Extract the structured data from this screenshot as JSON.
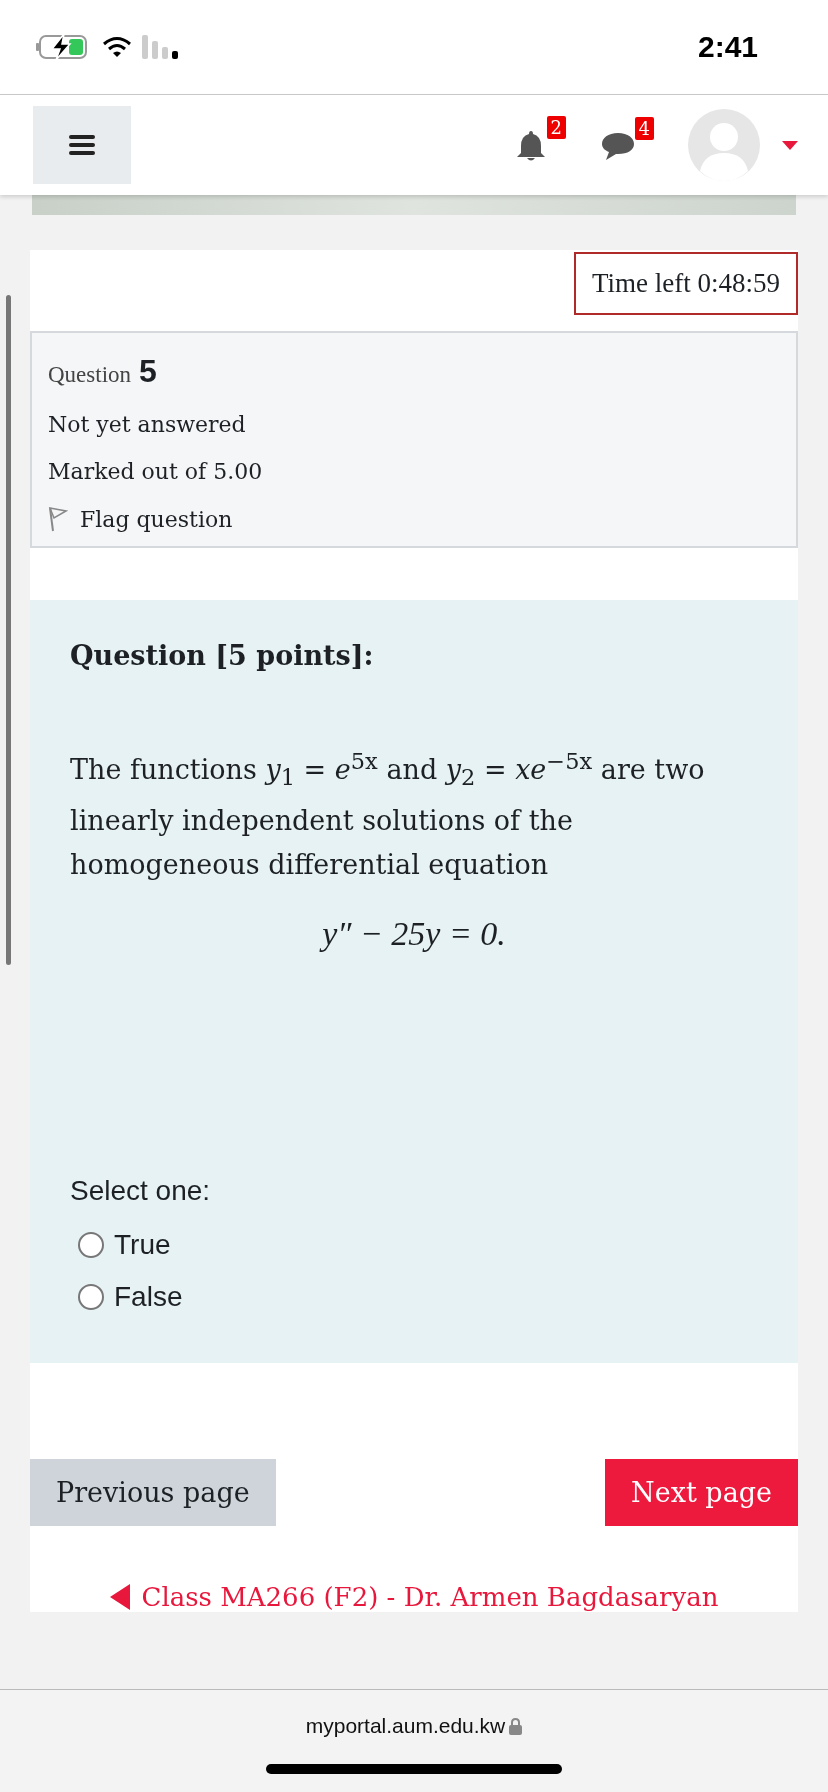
{
  "status_bar": {
    "time": "2:41"
  },
  "navbar": {
    "notifications": {
      "count": "2"
    },
    "messages": {
      "count": "4"
    }
  },
  "timer": {
    "text": "Time left 0:48:59"
  },
  "question_info": {
    "label": "Question",
    "number": "5",
    "state": "Not yet answered",
    "mark": "Marked out of 5.00",
    "flag": {
      "label": "Flag question",
      "flagged": false
    }
  },
  "question": {
    "title": "Question [5 points]:",
    "text": "The functions *y*$_{1}$ = *e*$^{5x}$ and *y*$_{2}$ = *xe*$^{−5x}$ are two linearly independent solutions of the homogeneous differential equation",
    "equation": "y″ − 25y = 0.",
    "prompt": "Select one:",
    "options": [
      {
        "label": "True",
        "selected": false
      },
      {
        "label": "False",
        "selected": false
      }
    ]
  },
  "buttons": [
    {
      "label": "Previous page",
      "kind": "secondary"
    },
    {
      "label": "Next page",
      "kind": "primary"
    }
  ],
  "course_link": {
    "text": "Class MA266 (F2) - Dr. Armen Bagdasaryan"
  },
  "browser_bar": {
    "url": "myportal.aum.edu.kw"
  }
}
